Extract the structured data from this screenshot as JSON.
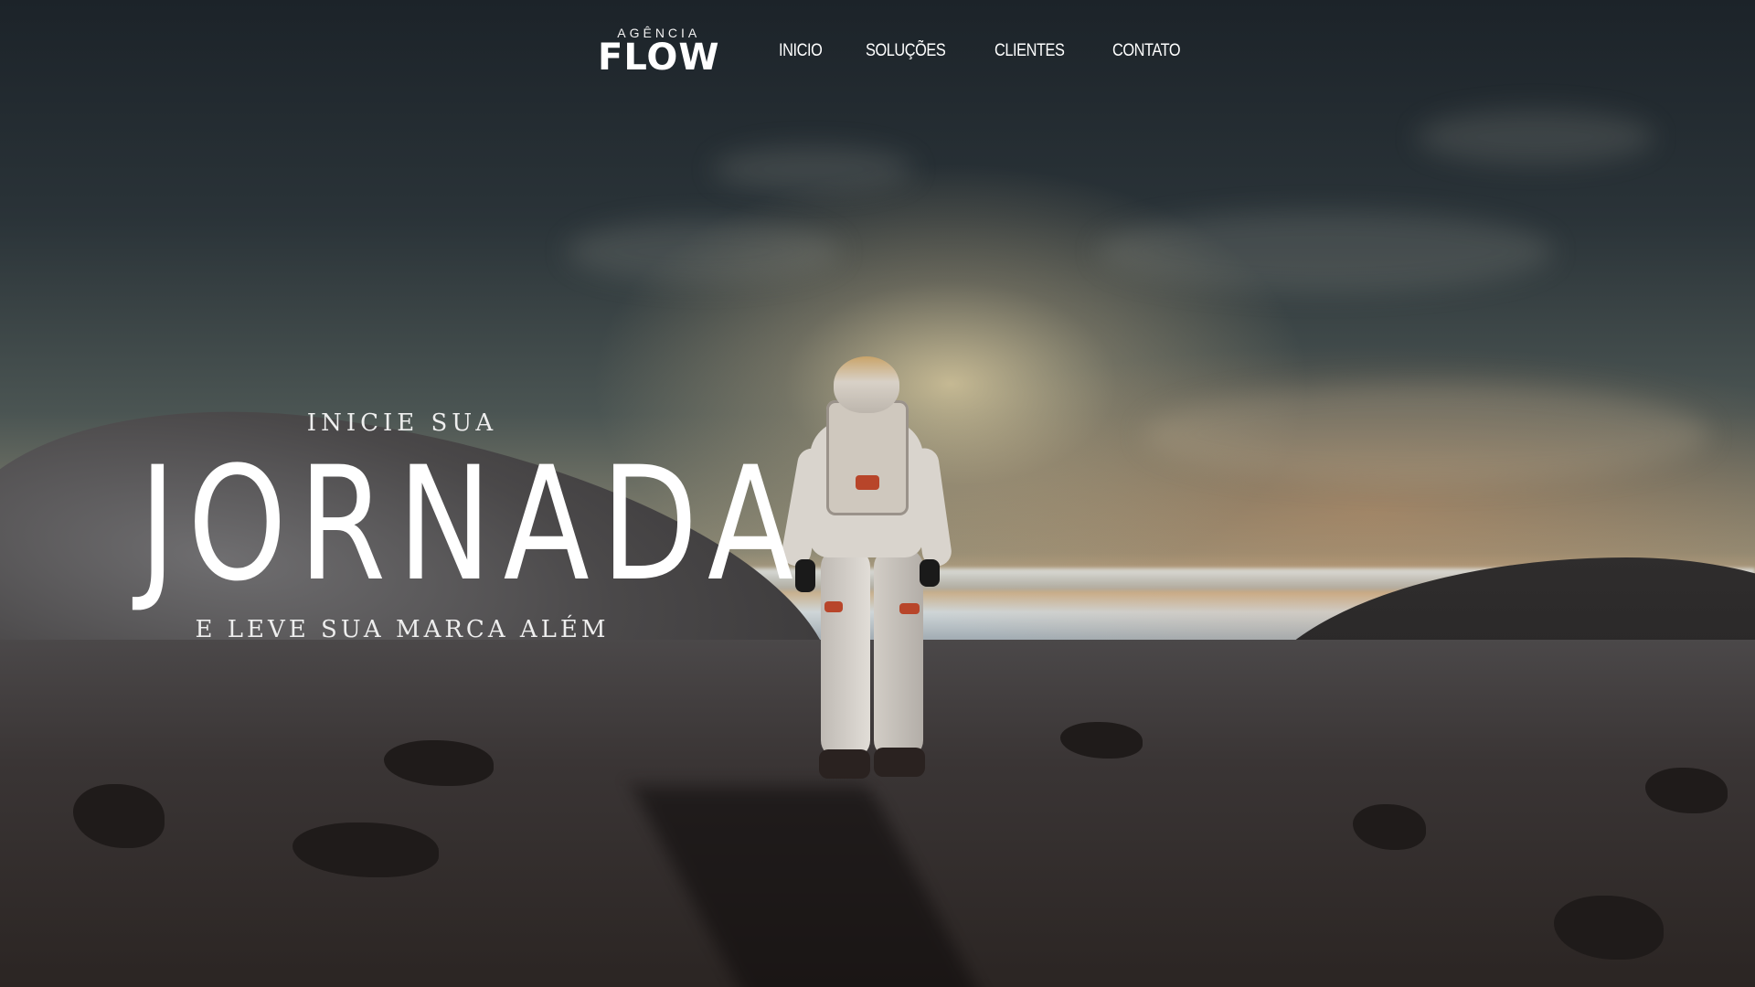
{
  "brand": {
    "sub": "AGÊNCIA",
    "name": "FLOW"
  },
  "nav": {
    "items": [
      "INICIO",
      "SOLUÇÕES",
      "CLIENTES",
      "CONTATO"
    ]
  },
  "hero": {
    "pre_title": "INICIE SUA",
    "title": "JORNADA",
    "post_title": "E LEVE SUA MARCA ALÉM",
    "background": "astronaut-on-planet-photo"
  },
  "colors": {
    "text": "#ffffff",
    "sky": "#2a3338",
    "horizon_glow": "#c9b08c",
    "ground": "#3a3535"
  }
}
